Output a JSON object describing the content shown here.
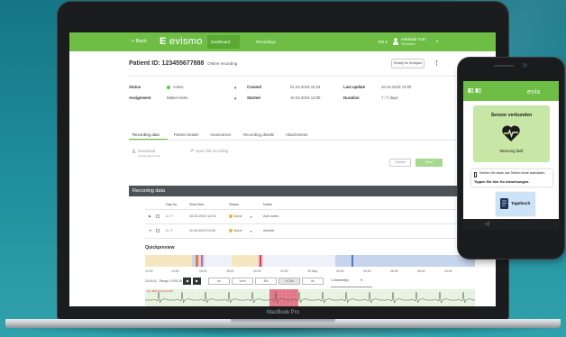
{
  "colors": {
    "brand_green": "#6ebe46",
    "light_green": "#c8e6a6",
    "dark_header": "#4d5256",
    "highlight_red": "#e45a78",
    "background": "#1d8b9a"
  },
  "laptop": {
    "device_label": "MacBook Pro",
    "nav": {
      "back": "< Back",
      "logo_prefix": "E",
      "logo_text": "evismo",
      "links": [
        "Dashboard",
        "Recordings"
      ],
      "lang": "EN",
      "lang_caret": "▾",
      "user_name": "Adelaide Tran",
      "user_role": "Technician",
      "user_caret": "▾",
      "user_icon": "user-icon"
    },
    "patient": {
      "id_label": "Patient ID: 123455677888",
      "recording_mode": "Online recording",
      "ready_button": "Ready for analysis",
      "menu_icon": "⋮"
    },
    "meta": {
      "status_label": "Status",
      "status_value": "Active",
      "assignment_label": "Assignment",
      "assignment_value": "Mabel Hicks",
      "created_label": "Created",
      "created_value": "01.04.2019 15:34",
      "started_label": "Started",
      "started_value": "10.04.2019 12:00",
      "last_update_label": "Last update",
      "last_update_value": "16.04.2019 12:00",
      "duration_label": "Duration",
      "duration_value": "7 / 7 days",
      "caret": "▼"
    },
    "tabs": [
      "Recording data",
      "Patient details",
      "Anamneses",
      "Recording details",
      "Attachments"
    ],
    "actions": {
      "download": "Download",
      "download_sub": "Include attachments",
      "open_full": "Open full recording",
      "cancel": "Cancel",
      "save": "Save"
    },
    "recording_section": {
      "title": "Recordng data",
      "columns": [
        "Day no.",
        "Start time",
        "Status",
        "Notes"
      ],
      "rows": [
        {
          "toggle": "▶",
          "day": "1 / 7",
          "start": "10.04.2019 12:00",
          "status": "Done",
          "caret": "▼",
          "notes": "Add notes"
        },
        {
          "toggle": "▼",
          "day": "2 / 7",
          "start": "11.04.2019 12:00",
          "status": "Done",
          "caret": "▼",
          "notes": "Activite"
        }
      ]
    },
    "quickpreview": {
      "title": "Quickpreview",
      "times": [
        "12:00",
        "14:00",
        "16:00",
        "18:00",
        "20:00",
        "22:00",
        "25 May",
        "02:00",
        "04:00",
        "06:00",
        "08:00",
        "10:00"
      ],
      "range_text": "15:40:11 - Range: 10:00:15",
      "prev": "◀",
      "next": "▶",
      "zoom_buttons": [
        "6s",
        "1min",
        "30s",
        "½ 10s",
        "5s"
      ],
      "zoom_active": 3,
      "channel_select": "1 channel(s)",
      "select_caret": "▼",
      "ecg_caption": "Ana. 39bp 0.5m (Cont 3x4)"
    }
  },
  "phone": {
    "brand": "evis",
    "status_icons": "▮▯ ▮▯",
    "card_title": "Sensor verbunden",
    "card_status": "Messung läuft",
    "heart_icon": "heart-rate-icon",
    "warn_text": "Denken Sie daran das Telefon heute aufzuladen.",
    "warn_link": "Tippen Sie hier für Anweisungen.",
    "diary_button": "Tagebuch",
    "diary_icon": "diary-icon",
    "nav_back": "◁"
  }
}
